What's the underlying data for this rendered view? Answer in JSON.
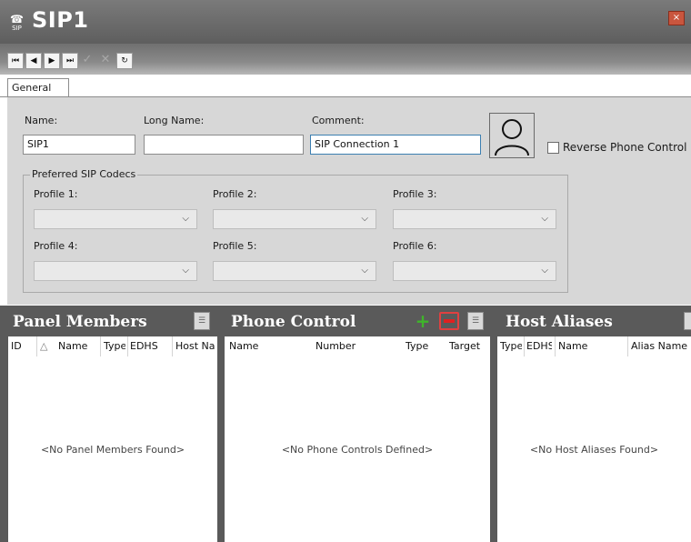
{
  "window": {
    "title": "SIP1",
    "icon_label": "SIP",
    "close_label": "×"
  },
  "nav": {
    "first": "⏮",
    "prev": "◀",
    "next": "▶",
    "last": "⏭",
    "save": "✓",
    "cancel": "✕",
    "refresh": "↻"
  },
  "tabs": [
    {
      "label": "General"
    }
  ],
  "form": {
    "name_label": "Name:",
    "name_value": "SIP1",
    "long_name_label": "Long Name:",
    "long_name_value": "",
    "comment_label": "Comment:",
    "comment_value": "SIP Connection 1",
    "reverse_phone_label": "Reverse Phone Control",
    "codecs_group_label": "Preferred SIP Codecs",
    "profiles": [
      {
        "label": "Profile 1:",
        "value": ""
      },
      {
        "label": "Profile 2:",
        "value": ""
      },
      {
        "label": "Profile 3:",
        "value": ""
      },
      {
        "label": "Profile 4:",
        "value": ""
      },
      {
        "label": "Profile 5:",
        "value": ""
      },
      {
        "label": "Profile 6:",
        "value": ""
      }
    ]
  },
  "panels": {
    "members": {
      "title": "Panel Members",
      "columns": [
        "ID",
        "△",
        "Name",
        "Type",
        "EDHS",
        "Host Name"
      ],
      "empty": "<No Panel Members Found>"
    },
    "phone": {
      "title": "Phone Control",
      "columns": [
        "Name",
        "Number",
        "Type",
        "Target"
      ],
      "empty": "<No Phone Controls Defined>"
    },
    "aliases": {
      "title": "Host Aliases",
      "columns": [
        "Type",
        "EDHS",
        "Name",
        "Alias Name"
      ],
      "empty": "<No Host Aliases Found>"
    }
  },
  "colors": {
    "titlebar": "#6b6b6b",
    "form_bg": "#d7d7d7",
    "panel_header": "#5a5a5a",
    "accent_focus": "#3c7fb1",
    "add_green": "#3fb52a",
    "remove_red": "#e02020"
  }
}
